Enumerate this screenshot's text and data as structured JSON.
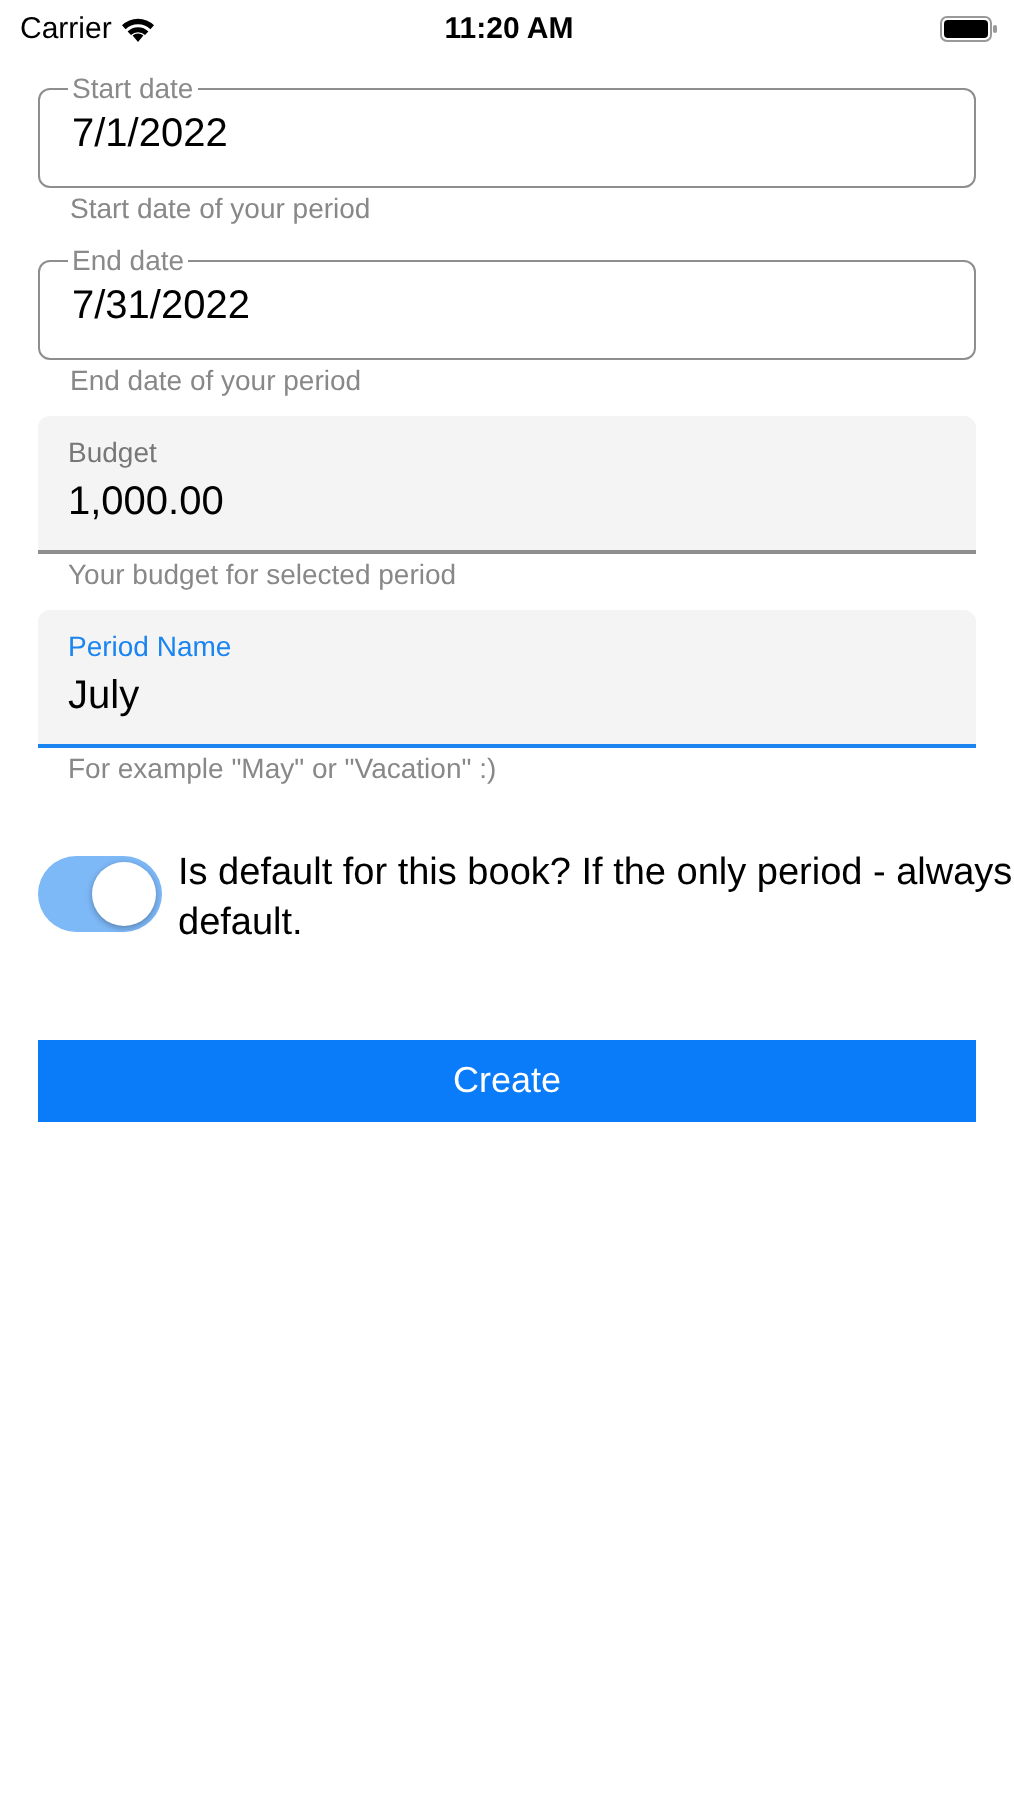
{
  "status_bar": {
    "carrier": "Carrier",
    "time": "11:20 AM"
  },
  "fields": [
    {
      "kind": "outlined",
      "label": "Start date",
      "value": "7/1/2022",
      "helper": "Start date of your period",
      "focused": false
    },
    {
      "kind": "outlined",
      "label": "End date",
      "value": "7/31/2022",
      "helper": "End date of your period",
      "focused": false
    },
    {
      "kind": "filled",
      "label": "Budget",
      "value": "1,000.00",
      "helper": "Your budget for selected period",
      "focused": false
    },
    {
      "kind": "filled",
      "label": "Period Name",
      "value": "July",
      "helper": "For example \"May\" or \"Vacation\" :)",
      "focused": true
    }
  ],
  "default_switch": {
    "label": "Is default for this book? If the only period - always default.",
    "on": true
  },
  "create_button": {
    "label": "Create"
  }
}
